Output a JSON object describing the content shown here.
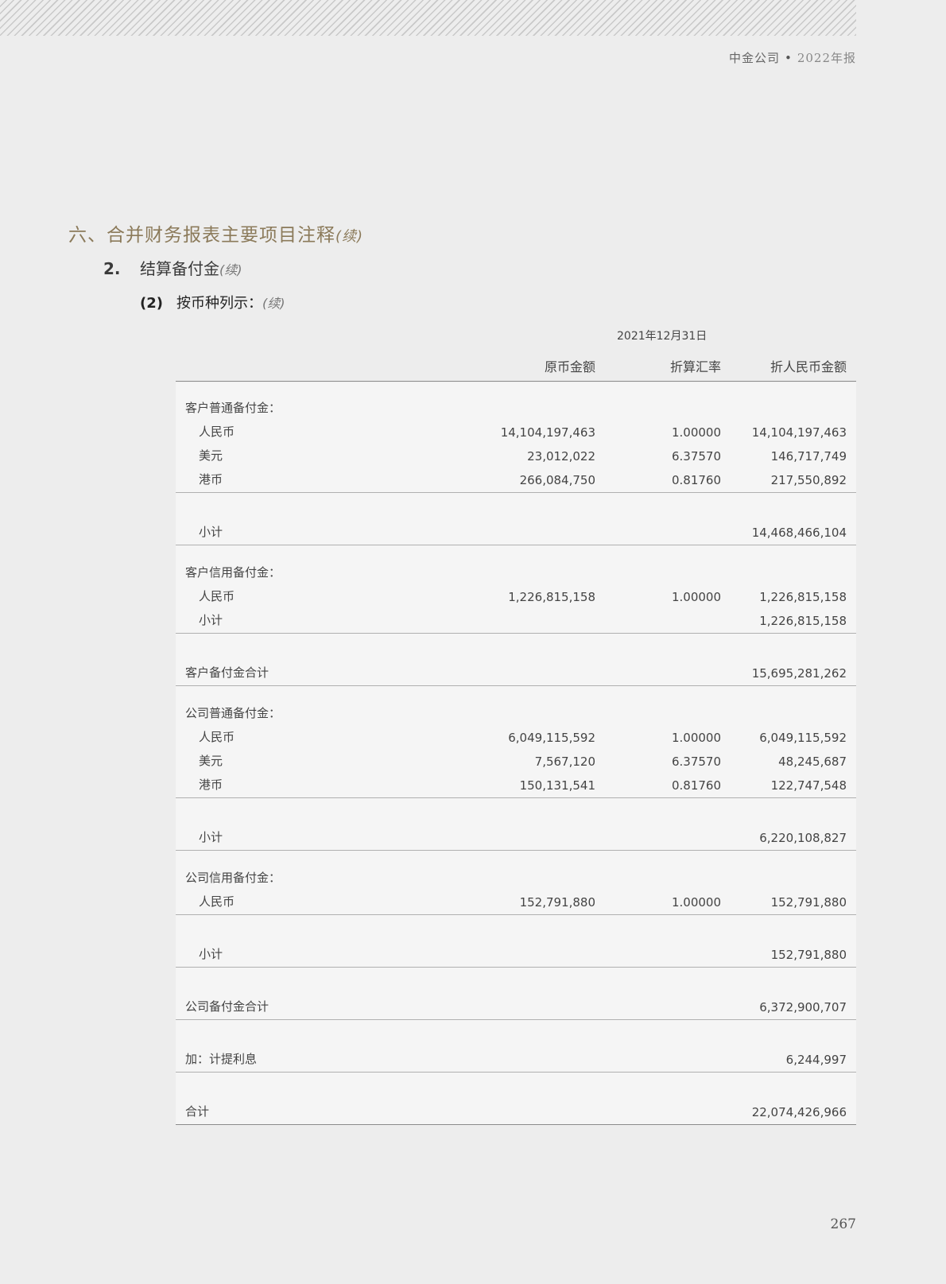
{
  "header": {
    "company": "中金公司",
    "separator": "•",
    "year_report": "2022年报"
  },
  "section": {
    "title": "六、合并财务报表主要项目注释",
    "cont": "(续)"
  },
  "subsection": {
    "num": "2.",
    "title": "结算备付金",
    "cont": "(续)"
  },
  "subsubsection": {
    "num": "(2)",
    "title": "按币种列示：",
    "cont": "(续)"
  },
  "table": {
    "period": "2021年12月31日",
    "columns": {
      "c1": "原币金额",
      "c2": "折算汇率",
      "c3": "折人民币金额"
    },
    "rows": {
      "r0": {
        "label": "客户普通备付金："
      },
      "r1": {
        "label": "人民币",
        "v1": "14,104,197,463",
        "v2": "1.00000",
        "v3": "14,104,197,463"
      },
      "r2": {
        "label": "美元",
        "v1": "23,012,022",
        "v2": "6.37570",
        "v3": "146,717,749"
      },
      "r3": {
        "label": "港币",
        "v1": "266,084,750",
        "v2": "0.81760",
        "v3": "217,550,892"
      },
      "r4": {
        "label": "小计",
        "v3": "14,468,466,104"
      },
      "r5": {
        "label": "客户信用备付金："
      },
      "r6": {
        "label": "人民币",
        "v1": "1,226,815,158",
        "v2": "1.00000",
        "v3": "1,226,815,158"
      },
      "r7": {
        "label": "小计",
        "v3": "1,226,815,158"
      },
      "r8": {
        "label": "客户备付金合计",
        "v3": "15,695,281,262"
      },
      "r9": {
        "label": "公司普通备付金："
      },
      "r10": {
        "label": "人民币",
        "v1": "6,049,115,592",
        "v2": "1.00000",
        "v3": "6,049,115,592"
      },
      "r11": {
        "label": "美元",
        "v1": "7,567,120",
        "v2": "6.37570",
        "v3": "48,245,687"
      },
      "r12": {
        "label": "港币",
        "v1": "150,131,541",
        "v2": "0.81760",
        "v3": "122,747,548"
      },
      "r13": {
        "label": "小计",
        "v3": "6,220,108,827"
      },
      "r14": {
        "label": "公司信用备付金："
      },
      "r15": {
        "label": "人民币",
        "v1": "152,791,880",
        "v2": "1.00000",
        "v3": "152,791,880"
      },
      "r16": {
        "label": "小计",
        "v3": "152,791,880"
      },
      "r17": {
        "label": "公司备付金合计",
        "v3": "6,372,900,707"
      },
      "r18": {
        "label": "加：计提利息",
        "v3": "6,244,997"
      },
      "r19": {
        "label": "合计",
        "v3": "22,074,426,966"
      }
    }
  },
  "page_number": "267"
}
